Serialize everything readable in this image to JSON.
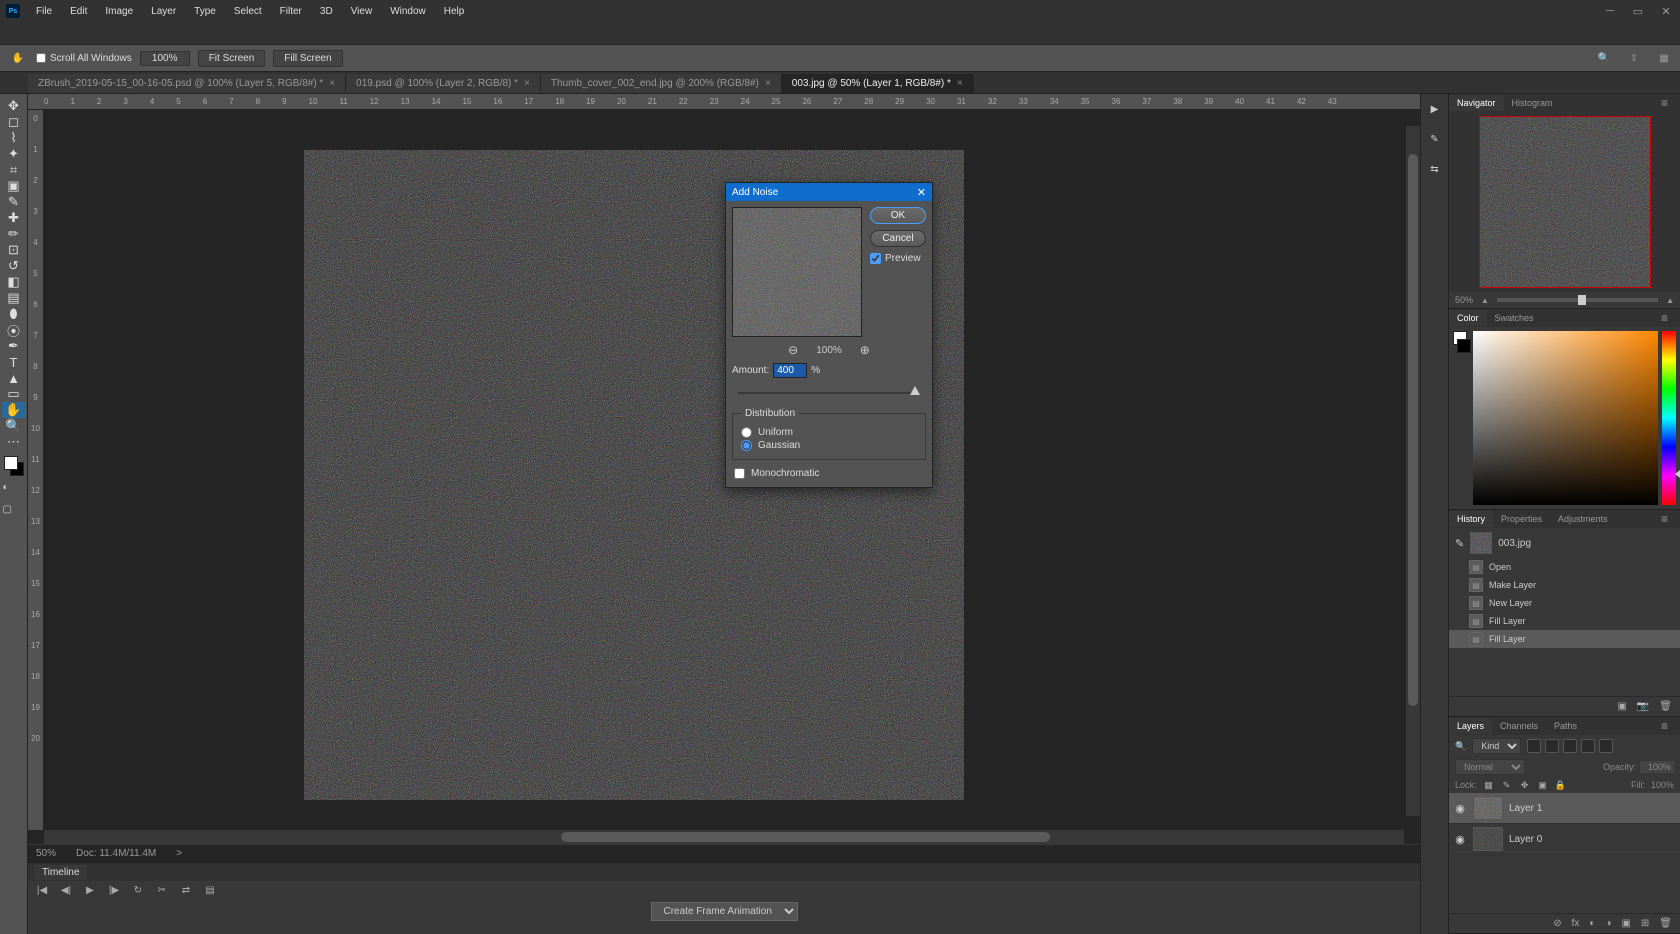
{
  "menubar": [
    "File",
    "Edit",
    "Image",
    "Layer",
    "Type",
    "Select",
    "Filter",
    "3D",
    "View",
    "Window",
    "Help"
  ],
  "optionsbar": {
    "scroll_all_label": "Scroll All Windows",
    "zoom_value": "100%",
    "fit_screen_label": "Fit Screen",
    "fill_screen_label": "Fill Screen"
  },
  "tabs": [
    {
      "label": "ZBrush_2019-05-15_00-16-05.psd @ 100% (Layer 5, RGB/8#) *",
      "active": false
    },
    {
      "label": "019.psd @ 100% (Layer 2, RGB/8) *",
      "active": false
    },
    {
      "label": "Thumb_cover_002_end.jpg @ 200% (RGB/8#)",
      "active": false
    },
    {
      "label": "003.jpg @ 50% (Layer 1, RGB/8#) *",
      "active": true
    }
  ],
  "ruler_marks_h": [
    "0",
    "1",
    "2",
    "3",
    "4",
    "5",
    "6",
    "7",
    "8",
    "9",
    "10",
    "11",
    "12",
    "13",
    "14",
    "15",
    "16",
    "17",
    "18",
    "19",
    "20",
    "21",
    "22",
    "23",
    "24",
    "25",
    "26",
    "27",
    "28",
    "29",
    "30",
    "31",
    "32",
    "33",
    "34",
    "35",
    "36",
    "37",
    "38",
    "39",
    "40",
    "41",
    "42",
    "43"
  ],
  "ruler_marks_v": [
    "0",
    "1",
    "2",
    "3",
    "4",
    "5",
    "6",
    "7",
    "8",
    "9",
    "10",
    "11",
    "12",
    "13",
    "14",
    "15",
    "16",
    "17",
    "18",
    "19",
    "20"
  ],
  "statusbar": {
    "zoom": "50%",
    "doc": "Doc: 11.4M/11.4M",
    "arrow": ">"
  },
  "timeline": {
    "title": "Timeline",
    "button_label": "Create Frame Animation"
  },
  "panels": {
    "navigator": {
      "tabs": [
        "Navigator",
        "Histogram"
      ],
      "zoom": "50%"
    },
    "color": {
      "tabs": [
        "Color",
        "Swatches"
      ],
      "fg_color": "#ffffff",
      "bg_color": "#000000"
    },
    "history": {
      "tabs": [
        "History",
        "Properties",
        "Adjustments"
      ],
      "root": "003.jpg",
      "items": [
        {
          "label": "Open",
          "sel": false
        },
        {
          "label": "Make Layer",
          "sel": false
        },
        {
          "label": "New Layer",
          "sel": false
        },
        {
          "label": "Fill Layer",
          "sel": false
        },
        {
          "label": "Fill Layer",
          "sel": true
        }
      ]
    },
    "layers": {
      "tabs": [
        "Layers",
        "Channels",
        "Paths"
      ],
      "kind_label": "Kind",
      "blend_mode": "Normal",
      "opacity_label": "Opacity:",
      "opacity_value": "100%",
      "lock_label": "Lock:",
      "fill_label": "Fill:",
      "fill_value": "100%",
      "layers": [
        {
          "name": "Layer 1",
          "sel": true
        },
        {
          "name": "Layer 0",
          "sel": false
        }
      ]
    }
  },
  "dialog": {
    "title": "Add Noise",
    "ok": "OK",
    "cancel": "Cancel",
    "preview_label": "Preview",
    "zoom": "100%",
    "amount_label": "Amount:",
    "amount_value": "400",
    "amount_unit": "%",
    "distribution_label": "Distribution",
    "uniform_label": "Uniform",
    "gaussian_label": "Gaussian",
    "mono_label": "Monochromatic"
  }
}
